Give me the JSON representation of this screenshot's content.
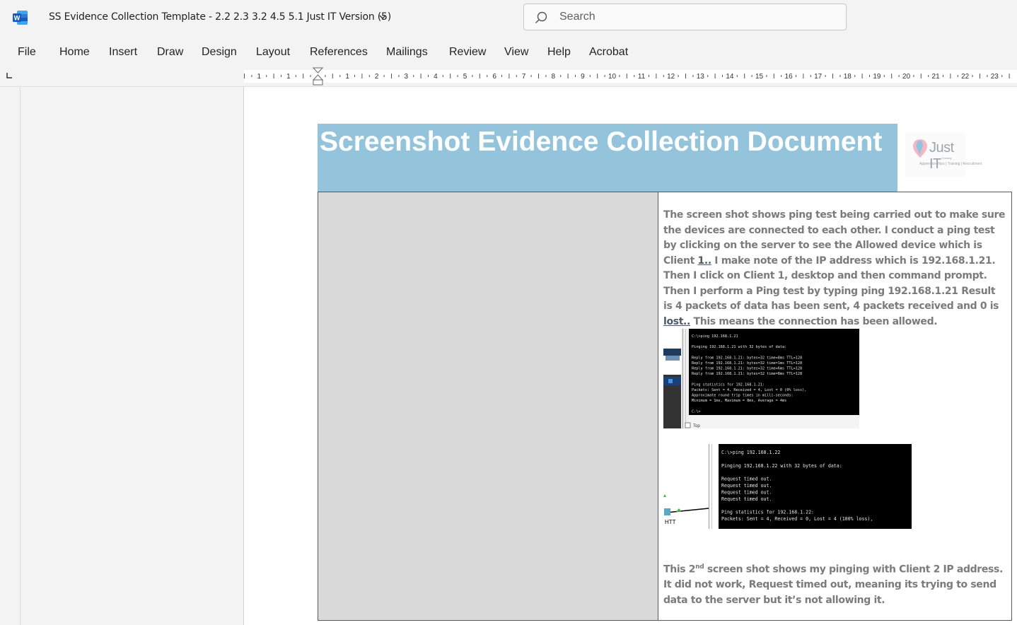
{
  "app": {
    "icon": "word-icon",
    "doc_title": "SS Evidence Collection Template - 2.2 2.3 3.2 4.5 5.1 Just IT Version (5)",
    "search_placeholder": "Search"
  },
  "menu": [
    "File",
    "Home",
    "Insert",
    "Draw",
    "Design",
    "Layout",
    "References",
    "Mailings",
    "Review",
    "View",
    "Help",
    "Acrobat"
  ],
  "ruler": {
    "left_labels": [
      "1"
    ],
    "numbers": [
      "1",
      "2",
      "3",
      "4",
      "5",
      "6",
      "7",
      "8",
      "9",
      "10",
      "11",
      "12",
      "13",
      "14",
      "15",
      "16",
      "17",
      "18",
      "19",
      "20",
      "21",
      "22",
      "23"
    ]
  },
  "document": {
    "banner_title": "Screenshot Evidence Collection Document",
    "logo": {
      "name": "Just IT",
      "tagline": "Apprenticeships | Training | Recruitment",
      "top": "Training"
    },
    "para1": {
      "t1": "The screen shot shows ping test being carried out to make sure the devices are connected to each other.  I conduct a ping test by clicking on the server to see the Allowed device which is Client ",
      "u1": "1..",
      "t2": " I make note of the IP address which is 192.168.1.21. Then I click on Client 1, desktop and then command prompt. Then I perform a Ping test by typing ping 192.168.1.21 Result is 4 packets of data has been sent, 4 packets received and 0 is ",
      "u2": "lost..",
      "t3": " This means the connection has been allowed."
    },
    "console1": {
      "lines": [
        "C:\\>ping 192.168.1.21",
        "",
        "Pinging 192.168.1.21 with 32 bytes of data:",
        "",
        "Reply from 192.168.1.21: bytes=32 time=8ms TTL=128",
        "Reply from 192.168.1.21: bytes=32 time=1ms TTL=128",
        "Reply from 192.168.1.21: bytes=32 time=6ms TTL=128",
        "Reply from 192.168.1.21: bytes=32 time=8ms TTL=128",
        "",
        "Ping statistics for 192.168.1.21:",
        "    Packets: Sent = 4, Received = 4, Lost = 0 (0% loss),",
        "Approximate round trip times in milli-seconds:",
        "    Minimum = 1ms, Maximum = 8ms, Average = 4ms",
        "",
        "C:\\>"
      ],
      "checkbox_label": "Top"
    },
    "console2": {
      "lines": [
        "C:\\>ping 192.168.1.22",
        "",
        "Pinging 192.168.1.22 with 32 bytes of data:",
        "",
        "Request timed out.",
        "Request timed out.",
        "Request timed out.",
        "Request timed out.",
        "",
        "Ping statistics for 192.168.1.22:",
        "    Packets: Sent = 4, Received = 0, Lost = 4 (100% loss),"
      ],
      "device_label": "HTT"
    },
    "para2": {
      "t1": "This 2",
      "sup": "nd",
      "t2": " screen shot shows my pinging with Client 2 IP address. It did not work, Request timed out, meaning its trying to send data to the server but it’s not allowing it."
    }
  },
  "colors": {
    "banner": "#94c4dc",
    "cell_gray": "#d9d9d9",
    "word_blue": "#185abd",
    "body_text": "#7b7b7b"
  }
}
